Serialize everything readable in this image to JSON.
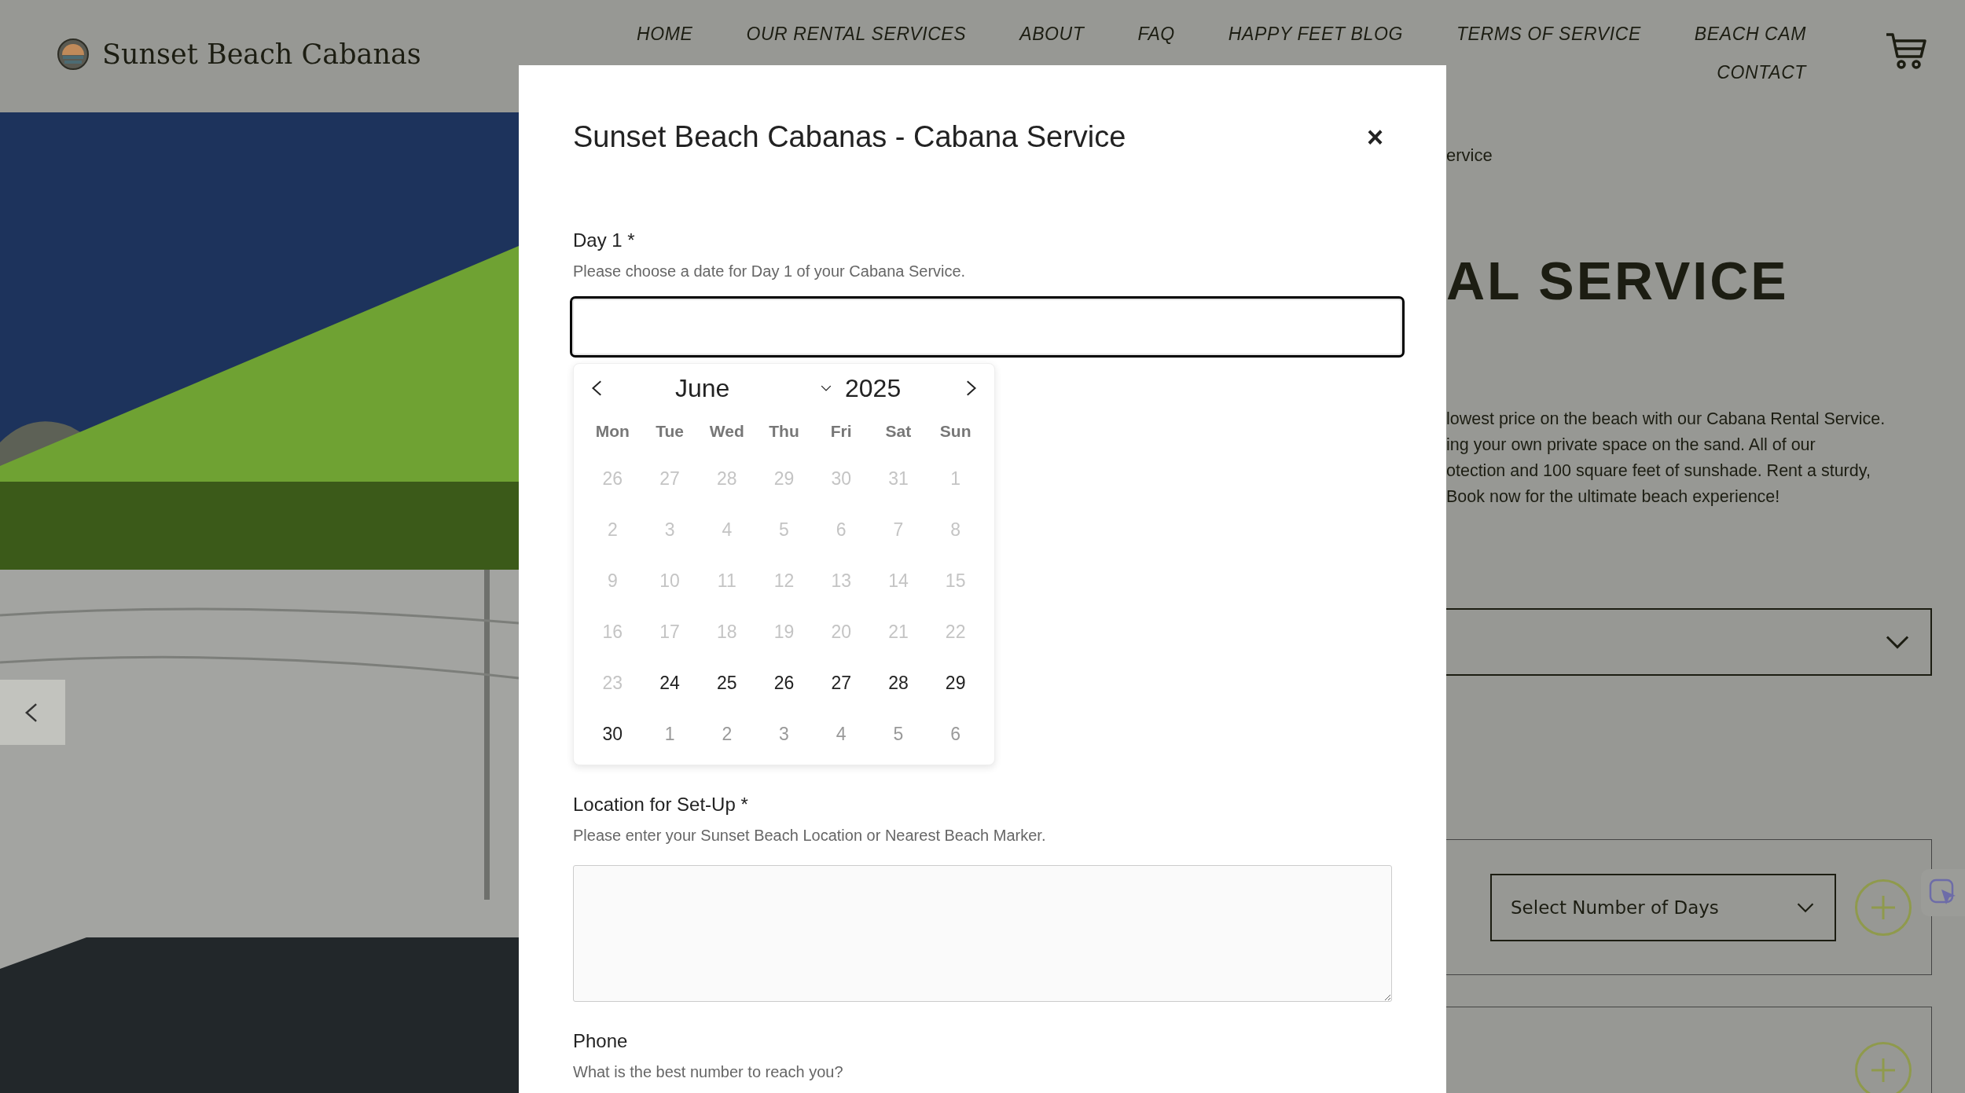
{
  "header": {
    "logo_text": "Sunset Beach Cabanas",
    "nav": [
      {
        "label": "HOME"
      },
      {
        "label": "OUR RENTAL SERVICES"
      },
      {
        "label": "ABOUT"
      },
      {
        "label": "FAQ"
      },
      {
        "label": "HAPPY FEET BLOG"
      },
      {
        "label": "TERMS OF SERVICE"
      },
      {
        "label": "BEACH CAM"
      },
      {
        "label": "CONTACT"
      }
    ]
  },
  "background": {
    "breadcrumb": "ervice",
    "heading": "AL SERVICE",
    "description_lines": [
      "lowest price on the beach with our Cabana Rental Service.",
      "ing your own private space on the sand. All of our",
      "otection and 100 square feet of sunshade. Rent a sturdy,",
      "Book now for the ultimate beach experience!"
    ],
    "days_select": "Select Number of Days"
  },
  "modal": {
    "title": "Sunset Beach Cabanas - Cabana Service",
    "close": "×",
    "fields": [
      {
        "kind": "date",
        "label": "Day 1 *",
        "hint": "Please choose a date for Day 1 of your Cabana Service.",
        "focused": true
      },
      {
        "kind": "textarea",
        "label": "Location for Set-Up *",
        "hint": "Please enter your Sunset Beach Location or Nearest Beach Marker."
      },
      {
        "kind": "text",
        "label": "Phone",
        "hint": "What is the best number to reach you?"
      }
    ]
  },
  "calendar": {
    "month": "June",
    "year": "2025",
    "weekdays": [
      "Mon",
      "Tue",
      "Wed",
      "Thu",
      "Fri",
      "Sat",
      "Sun"
    ],
    "days": [
      {
        "day": "26",
        "kind": "disabled"
      },
      {
        "day": "27",
        "kind": "disabled"
      },
      {
        "day": "28",
        "kind": "disabled"
      },
      {
        "day": "29",
        "kind": "disabled"
      },
      {
        "day": "30",
        "kind": "disabled"
      },
      {
        "day": "31",
        "kind": "disabled"
      },
      {
        "day": "1",
        "kind": "disabled"
      },
      {
        "day": "2",
        "kind": "disabled"
      },
      {
        "day": "3",
        "kind": "disabled"
      },
      {
        "day": "4",
        "kind": "disabled"
      },
      {
        "day": "5",
        "kind": "disabled"
      },
      {
        "day": "6",
        "kind": "disabled"
      },
      {
        "day": "7",
        "kind": "disabled"
      },
      {
        "day": "8",
        "kind": "disabled"
      },
      {
        "day": "9",
        "kind": "disabled"
      },
      {
        "day": "10",
        "kind": "disabled"
      },
      {
        "day": "11",
        "kind": "disabled"
      },
      {
        "day": "12",
        "kind": "disabled"
      },
      {
        "day": "13",
        "kind": "disabled"
      },
      {
        "day": "14",
        "kind": "disabled"
      },
      {
        "day": "15",
        "kind": "disabled"
      },
      {
        "day": "16",
        "kind": "disabled"
      },
      {
        "day": "17",
        "kind": "disabled"
      },
      {
        "day": "18",
        "kind": "disabled"
      },
      {
        "day": "19",
        "kind": "disabled"
      },
      {
        "day": "20",
        "kind": "disabled"
      },
      {
        "day": "21",
        "kind": "disabled"
      },
      {
        "day": "22",
        "kind": "disabled"
      },
      {
        "day": "23",
        "kind": "disabled"
      },
      {
        "day": "24",
        "kind": "available"
      },
      {
        "day": "25",
        "kind": "available"
      },
      {
        "day": "26",
        "kind": "available"
      },
      {
        "day": "27",
        "kind": "available"
      },
      {
        "day": "28",
        "kind": "available"
      },
      {
        "day": "29",
        "kind": "available"
      },
      {
        "day": "30",
        "kind": "available"
      },
      {
        "day": "1",
        "kind": "other_month"
      },
      {
        "day": "2",
        "kind": "other_month"
      },
      {
        "day": "3",
        "kind": "other_month"
      },
      {
        "day": "4",
        "kind": "other_month"
      },
      {
        "day": "5",
        "kind": "other_month"
      },
      {
        "day": "6",
        "kind": "other_month"
      }
    ]
  }
}
